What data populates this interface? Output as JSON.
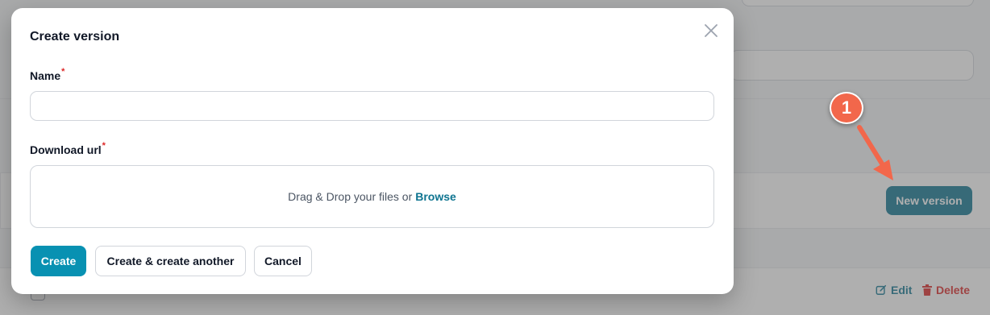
{
  "modal": {
    "title": "Create version",
    "name_label": "Name",
    "required_mark": "*",
    "name_value": "",
    "download_url_label": "Download url",
    "dropzone_text": "Drag & Drop your files or",
    "dropzone_browse": "Browse",
    "buttons": {
      "create": "Create",
      "create_another": "Create & create another",
      "cancel": "Cancel"
    }
  },
  "background": {
    "new_version_button": "New version",
    "edit_action": "Edit",
    "delete_action": "Delete"
  },
  "annotation": {
    "step_number": "1"
  },
  "colors": {
    "primary": "#0891b2",
    "primary_dark": "#0e7490",
    "danger": "#dc2626",
    "annotation": "#f2674b"
  }
}
